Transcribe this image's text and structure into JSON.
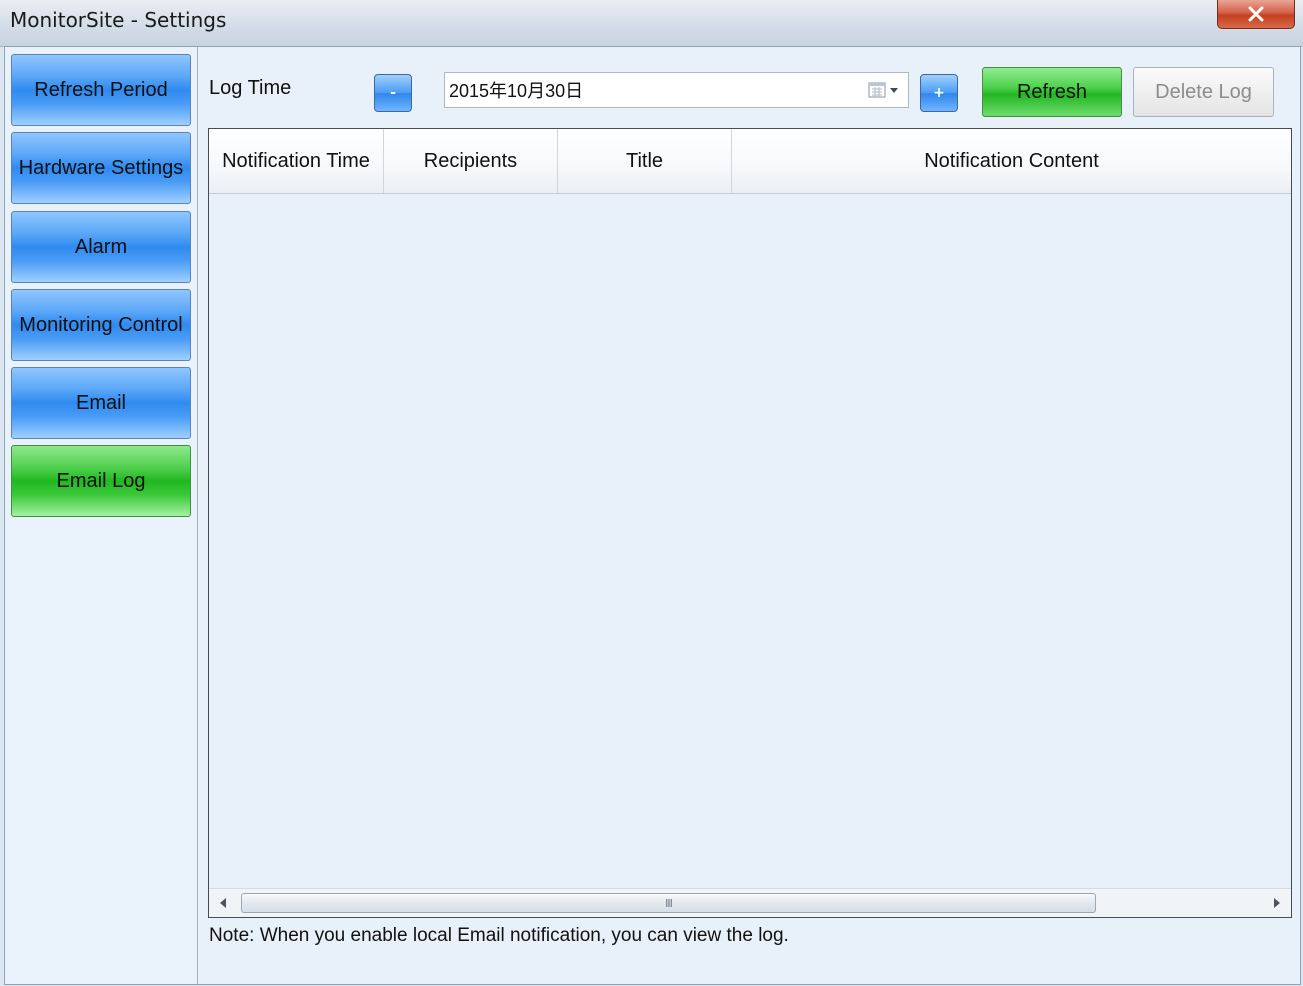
{
  "window": {
    "title": "MonitorSite - Settings"
  },
  "sidebar": {
    "items": [
      {
        "label": "Refresh Period"
      },
      {
        "label": "Hardware Settings"
      },
      {
        "label": "Alarm"
      },
      {
        "label": "Monitoring Control"
      },
      {
        "label": "Email"
      },
      {
        "label": "Email Log"
      }
    ],
    "active_index": 5
  },
  "toolbar": {
    "log_time_label": "Log Time",
    "decrement_label": "-",
    "date_value": "2015年10月30日",
    "increment_label": "+",
    "refresh_label": "Refresh",
    "delete_log_label": "Delete Log"
  },
  "table": {
    "columns": [
      "Notification Time",
      "Recipients",
      "Title",
      "Notification Content"
    ],
    "rows": [],
    "scroll_grip": "III"
  },
  "note": "Note: When you enable local Email notification, you can view the log.",
  "colors": {
    "nav_blue": "#2f8af0",
    "nav_active_green": "#22b822",
    "refresh_green": "#22b722",
    "close_red": "#c3401f"
  }
}
